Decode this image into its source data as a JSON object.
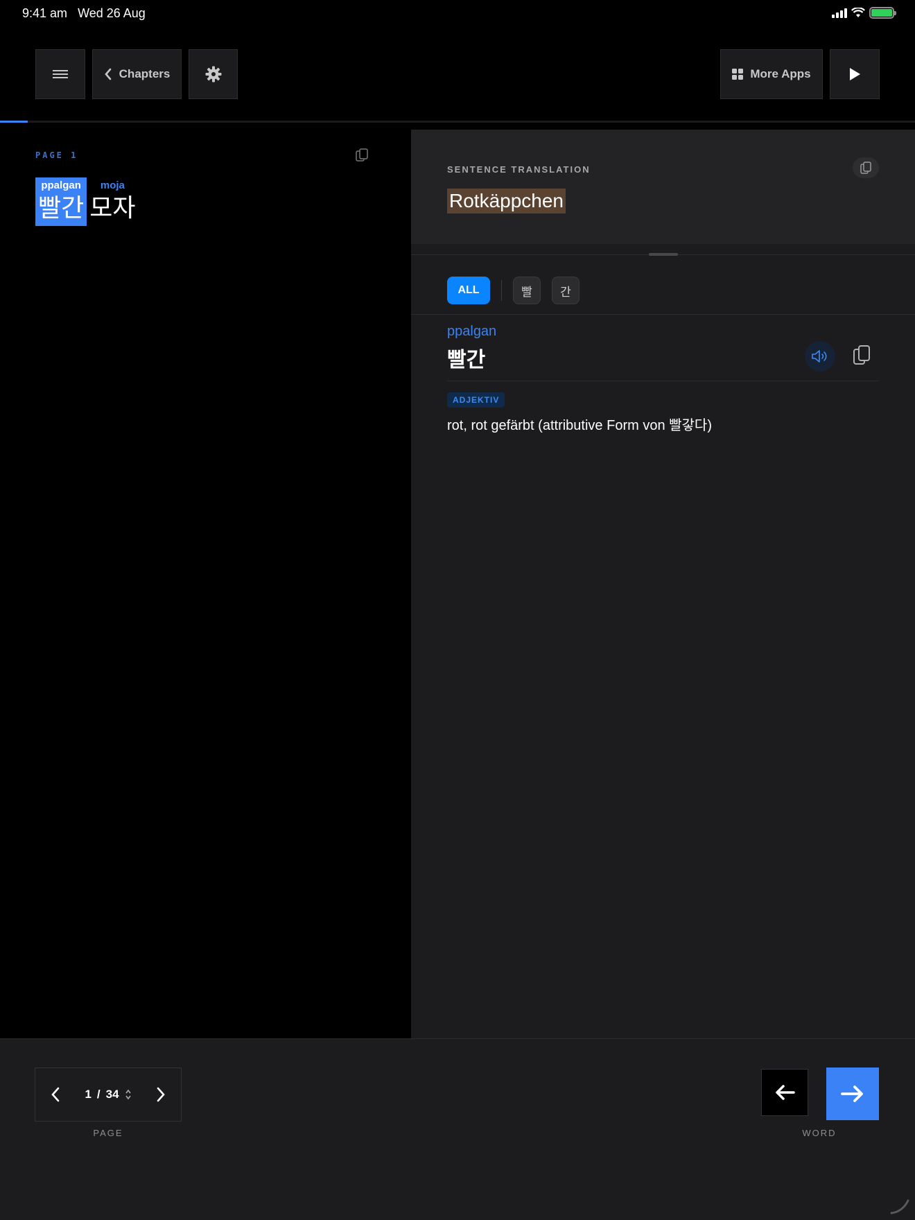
{
  "status_bar": {
    "time": "9:41 am",
    "date": "Wed 26 Aug"
  },
  "toolbar": {
    "chapters_label": "Chapters",
    "more_apps_label": "More Apps"
  },
  "reading_progress": 0.03,
  "left_panel": {
    "page_label": "PAGE 1",
    "words": [
      {
        "romanization": "ppalgan",
        "korean": "빨간",
        "active": true
      },
      {
        "romanization": "moja",
        "korean": "모자",
        "active": false
      }
    ]
  },
  "right_panel": {
    "section_label": "SENTENCE TRANSLATION",
    "translation": "Rotkäppchen",
    "filters": {
      "all_label": "ALL",
      "syllables": [
        "빨",
        "간"
      ]
    },
    "entry": {
      "romanization": "ppalgan",
      "korean": "빨간",
      "part_of_speech": "ADJEKTIV",
      "definition": "rot, rot gefärbt (attributive Form von 빨갛다)"
    }
  },
  "bottom": {
    "current_page": "1",
    "separator": "/",
    "total_pages": "34",
    "page_label": "PAGE",
    "word_label": "WORD"
  },
  "colors": {
    "accent": "#3b82f6",
    "filter_active": "#0a84ff",
    "highlight": "#5a4330",
    "battery": "#30d158"
  },
  "icons": [
    "menu-icon",
    "chevron-left-icon",
    "gear-icon",
    "grid-icon",
    "play-icon",
    "copy-icon",
    "speaker-icon",
    "chevron-right-icon",
    "sort-icon",
    "arrow-left-icon",
    "arrow-right-icon"
  ]
}
